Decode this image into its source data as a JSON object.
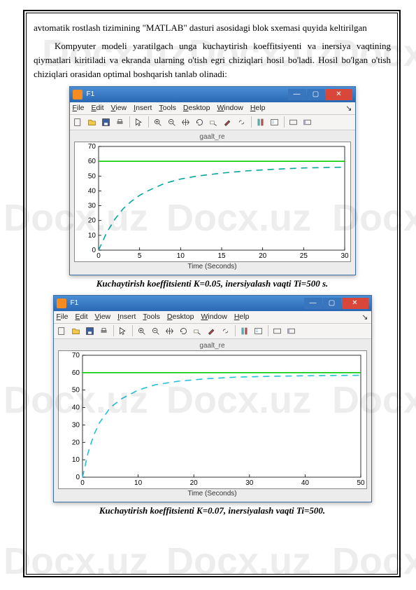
{
  "watermark": "Docx.uz",
  "body": {
    "para1": "avtomatik rostlash tizimining \"MATLAB\" dasturi asosidagi blok sxemasi quyida keltirilgan",
    "para2": "Kompyuter modeli yaratilgach unga kuchaytirish koeffitsiyenti va inersiya vaqtining qiymatlari kiritiladi va ekranda ularning o'tish egri chiziqlari hosil bo'ladi. Hosil bo'lgan o'tish chiziqlari orasidan optimal boshqarish tanlab olinadi:"
  },
  "figures": [
    {
      "window_title": "F1",
      "menu": [
        "File",
        "Edit",
        "View",
        "Insert",
        "Tools",
        "Desktop",
        "Window",
        "Help"
      ],
      "plot_title": "gaalt_re",
      "xlabel": "Time (Seconds)",
      "caption": "Kuchaytirish koeffitsienti K=0.05, inersiyalash vaqti Ti=500 s."
    },
    {
      "window_title": "F1",
      "menu": [
        "File",
        "Edit",
        "View",
        "Insert",
        "Tools",
        "Desktop",
        "Window",
        "Help"
      ],
      "plot_title": "gaalt_re",
      "xlabel": "Time (Seconds)",
      "caption": "Kuchaytirish koeffitsienti K=0.07, inersiyalash vaqti Ti=500."
    }
  ],
  "chart_data": [
    {
      "type": "line",
      "title": "gaalt_re",
      "xlabel": "Time (Seconds)",
      "ylabel": "",
      "xlim": [
        0,
        30
      ],
      "ylim": [
        0,
        70
      ],
      "xticks": [
        0,
        5,
        10,
        15,
        20,
        25,
        30
      ],
      "yticks": [
        0,
        10,
        20,
        30,
        40,
        50,
        60,
        70
      ],
      "series": [
        {
          "name": "reference",
          "color": "#00cc00",
          "dash": false,
          "x": [
            0,
            30
          ],
          "y": [
            60,
            60
          ]
        },
        {
          "name": "response",
          "color": "#00a8a0",
          "dash": true,
          "x": [
            0,
            1,
            2,
            3,
            4,
            5,
            6,
            8,
            10,
            12,
            15,
            18,
            21,
            25,
            30
          ],
          "y": [
            0,
            12,
            21,
            28,
            33,
            37,
            40,
            45,
            48,
            50,
            52,
            53.5,
            54.5,
            55.5,
            56
          ]
        }
      ]
    },
    {
      "type": "line",
      "title": "gaalt_re",
      "xlabel": "Time (Seconds)",
      "ylabel": "",
      "xlim": [
        0,
        50
      ],
      "ylim": [
        0,
        70
      ],
      "xticks": [
        0,
        10,
        20,
        30,
        40,
        50
      ],
      "yticks": [
        0,
        10,
        20,
        30,
        40,
        50,
        60,
        70
      ],
      "series": [
        {
          "name": "reference",
          "color": "#00cc00",
          "dash": false,
          "x": [
            0,
            50
          ],
          "y": [
            60,
            60
          ]
        },
        {
          "name": "response",
          "color": "#20c0d8",
          "dash": true,
          "x": [
            0,
            1,
            2,
            3,
            5,
            7,
            10,
            13,
            17,
            22,
            28,
            35,
            42,
            50
          ],
          "y": [
            0,
            14,
            24,
            31,
            40,
            45,
            50,
            53,
            55,
            56.5,
            57.5,
            58,
            58.3,
            58.5
          ]
        }
      ]
    }
  ],
  "colors": {
    "titlebar_start": "#4a8ed6",
    "titlebar_end": "#2a68b3",
    "close_btn": "#d9473b"
  }
}
